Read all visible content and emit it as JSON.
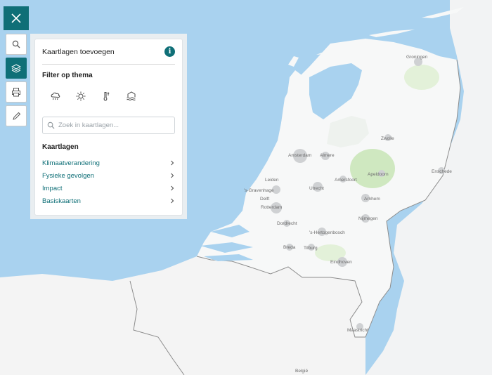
{
  "map": {
    "labels": {
      "groningen": "Groningen",
      "zwolle": "Zwolle",
      "amsterdam": "Amsterdam",
      "almere": "Almere",
      "leiden": "Leiden",
      "amersfoort": "Amersfoort",
      "apeldoorn": "Apeldoorn",
      "enschede": "Enschede",
      "den_haag": "'s-Gravenhage",
      "delft": "Delft",
      "utrecht": "Utrecht",
      "arnhem": "Arnhem",
      "rotterdam": "Rotterdam",
      "dordrecht": "Dordrecht",
      "nijmegen": "Nijmegen",
      "den_bosch": "'s-Hertogenbosch",
      "breda": "Breda",
      "tilburg": "Tilburg",
      "eindhoven": "Eindhoven",
      "maastricht": "Maastricht",
      "belgie": "België"
    },
    "colors": {
      "water": "#a9d2ef",
      "land": "#f7f8f8",
      "urban": "#cfd1d3",
      "forest": "#cfe8c0"
    }
  },
  "close_button": {
    "icon": "close-icon"
  },
  "toolbar": {
    "items": [
      {
        "name": "search",
        "icon": "search-icon",
        "active": false
      },
      {
        "name": "layers",
        "icon": "layers-icon",
        "active": true
      },
      {
        "name": "print",
        "icon": "print-icon",
        "active": false
      },
      {
        "name": "draw",
        "icon": "pencil-icon",
        "active": false
      }
    ]
  },
  "panel": {
    "title": "Kaartlagen toevoegen",
    "info_icon": "i",
    "filter_title": "Filter op thema",
    "themes": [
      "rain-cloud-icon",
      "sun-icon",
      "thermometer-icon",
      "flood-icon"
    ],
    "search_placeholder": "Zoek in kaartlagen...",
    "layers_title": "Kaartlagen",
    "layers": [
      "Klimaatverandering",
      "Fysieke gevolgen",
      "Impact",
      "Basiskaarten"
    ]
  },
  "accent_color": "#0f6f77"
}
